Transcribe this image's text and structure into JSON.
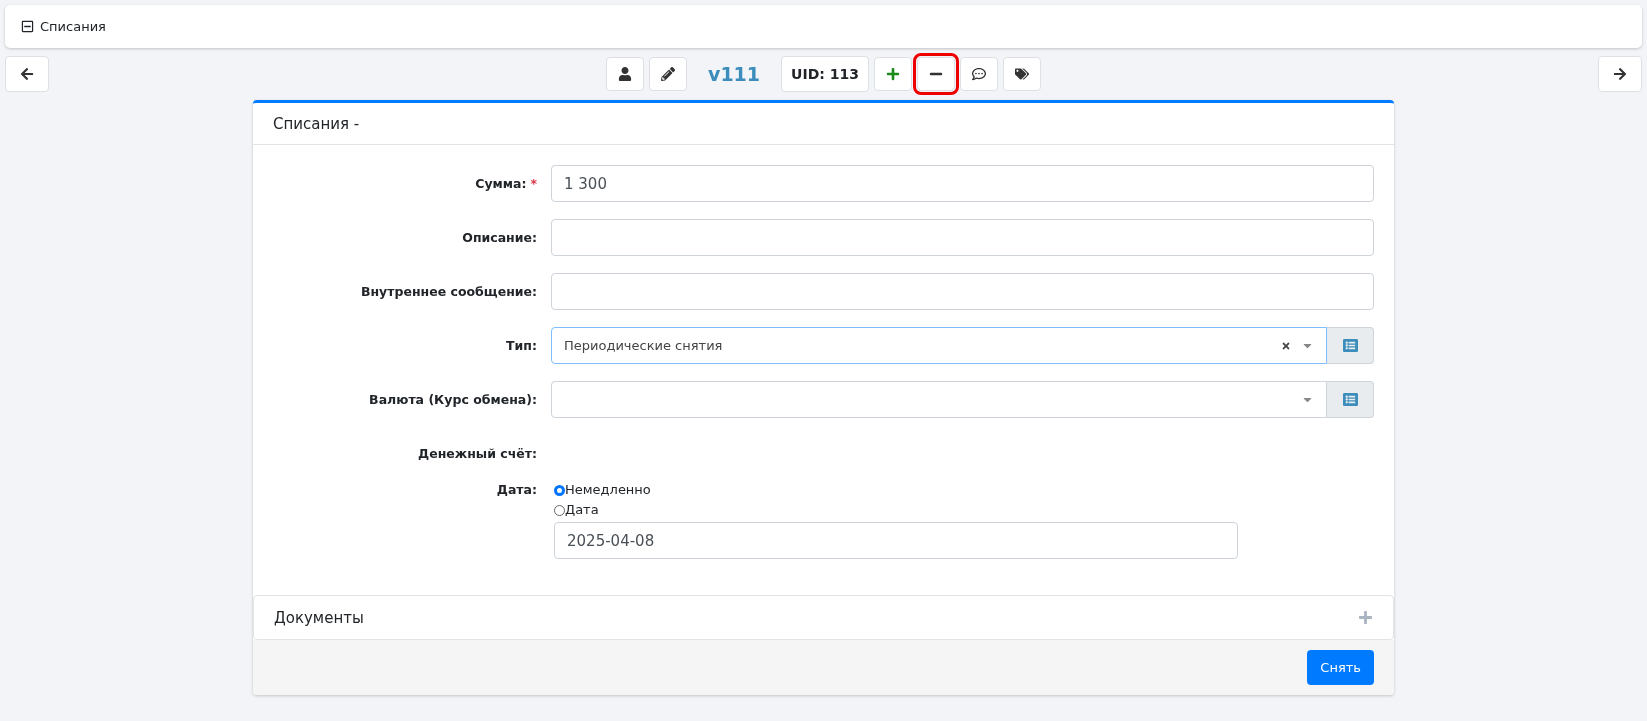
{
  "header": {
    "title": "Списания",
    "expanded": true
  },
  "toolbar": [
    {
      "kind": "icon",
      "highlighted": false
    },
    {
      "kind": "icon",
      "highlighted": false
    },
    {
      "kind": "version",
      "text": "v111"
    },
    {
      "kind": "badge",
      "text": "UID: 113"
    },
    {
      "kind": "icon",
      "highlighted": false
    },
    {
      "kind": "icon",
      "highlighted": true
    },
    {
      "kind": "icon",
      "highlighted": false
    },
    {
      "kind": "icon",
      "highlighted": false
    }
  ],
  "card": {
    "title": "Списания -",
    "fields": [
      {
        "kind": "text",
        "label": "Сумма:",
        "required_mark": "*",
        "value": "1 300"
      },
      {
        "kind": "text",
        "label": "Описание:"
      },
      {
        "kind": "text",
        "label": "Внутреннее сообщение:"
      },
      {
        "kind": "select",
        "label": "Тип:",
        "value": "Периодические снятия",
        "focused": true
      },
      {
        "kind": "select",
        "label": "Валюта (Курс обмена):",
        "focused": false
      },
      {
        "kind": "static",
        "label": "Денежный счёт:"
      },
      {
        "kind": "date",
        "label": "Дата:",
        "options": [
          {
            "label": "Немедленно",
            "selected": true
          },
          {
            "label": "Дата",
            "selected": false
          }
        ],
        "value": "2025-04-08"
      }
    ]
  },
  "documents": {
    "title": "Документы"
  },
  "submit": "Снять"
}
